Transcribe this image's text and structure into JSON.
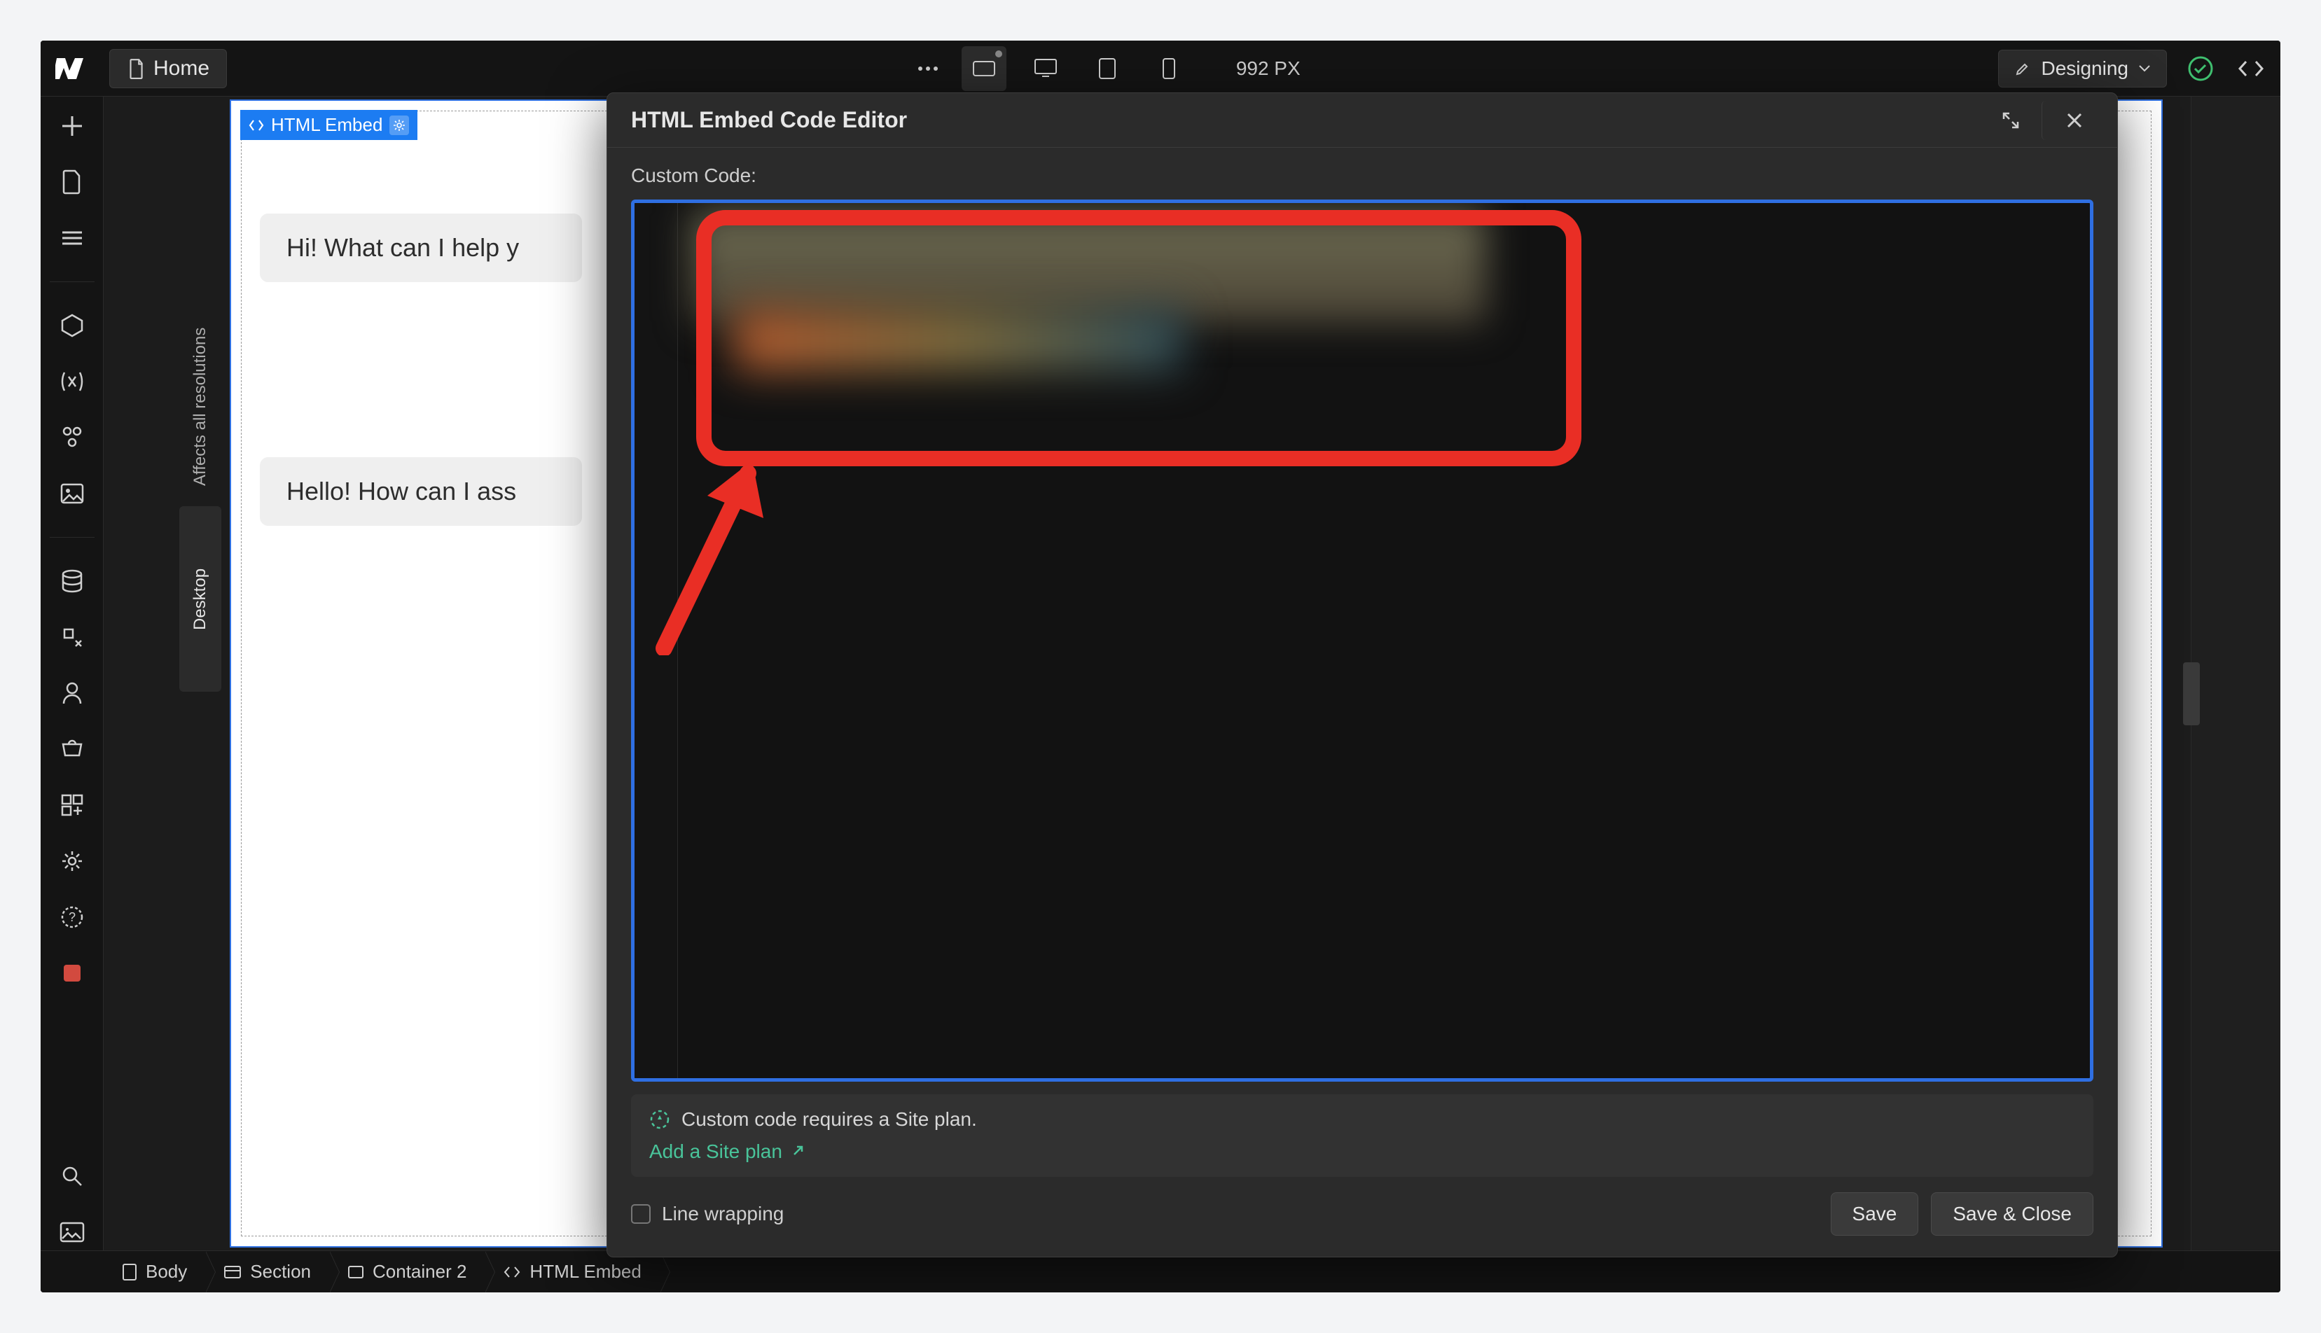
{
  "topbar": {
    "home_label": "Home",
    "px_readout": "992 PX",
    "designing_label": "Designing"
  },
  "canvas": {
    "element_tag_label": "HTML Embed",
    "chat_bubble_1": "Hi! What can I help y",
    "chat_bubble_2": "Hello! How can I ass"
  },
  "vertical_badge": {
    "top_text": "Affects all resolutions",
    "bottom_text": "Desktop"
  },
  "modal": {
    "title": "HTML Embed Code Editor",
    "custom_code_label": "Custom Code:",
    "info_text": "Custom code requires a Site plan.",
    "info_link_label": "Add a Site plan",
    "line_wrapping_label": "Line wrapping",
    "save_label": "Save",
    "save_close_label": "Save & Close"
  },
  "breadcrumb": [
    "Body",
    "Section",
    "Container 2",
    "HTML Embed"
  ],
  "icons": {
    "logo": "webflow-logo",
    "page": "page-icon",
    "dots": "ellipsis-icon",
    "bp_add": "add-breakpoint-icon",
    "bp_desktop": "desktop-icon",
    "bp_tablet": "tablet-icon",
    "bp_phone": "phone-icon",
    "brush": "brush-icon",
    "chevron": "chevron-down-icon",
    "check": "check-circle-icon",
    "code": "code-icon",
    "expand": "expand-icon",
    "close": "close-icon",
    "info": "info-dashed-icon",
    "external": "external-link-icon"
  }
}
